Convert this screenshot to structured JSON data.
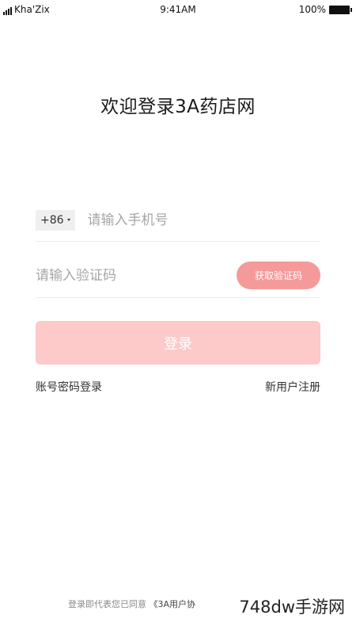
{
  "status_bar": {
    "carrier": "Kha'Zix",
    "time": "9:41AM",
    "battery": "100%"
  },
  "title": "欢迎登录3A药店网",
  "phone": {
    "country_code": "+86",
    "placeholder": "请输入手机号"
  },
  "code": {
    "placeholder": "请输入验证码",
    "get_code_label": "获取验证码"
  },
  "login_label": "登录",
  "links": {
    "password_login": "账号密码登录",
    "register": "新用户注册"
  },
  "agreement": {
    "prefix": "登录即代表您已同意",
    "document": "《3A用户协"
  },
  "watermark": "748dw手游网",
  "colors": {
    "get_code_button": "#f59a9a",
    "login_button": "#fdc9c9"
  }
}
